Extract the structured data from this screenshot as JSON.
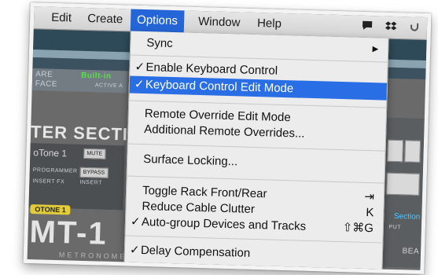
{
  "menubar": {
    "items": [
      {
        "label": "Edit"
      },
      {
        "label": "Create"
      },
      {
        "label": "Options"
      },
      {
        "label": "Window"
      },
      {
        "label": "Help"
      }
    ]
  },
  "background_app": {
    "section_title": "TER SECTION",
    "green_text": "Built-in",
    "label_are": "ARE",
    "label_face": "FACE",
    "label_active": "ACTIVE A",
    "tone_name": "oTone 1",
    "mute": "MUTE",
    "programmer": "PROGRAMMER",
    "bypass": "BYPASS",
    "insert_fx": "INSERT FX",
    "insert": "INSERT",
    "tag": "OTONE 1",
    "big_logo": "MT-1",
    "metronome": "METRONOME",
    "right_section": "Section",
    "right_put": "PUT",
    "right_bea": "BEA"
  },
  "options_menu": {
    "items": [
      {
        "label": "Sync",
        "checked": false,
        "shortcut": "▶"
      },
      {
        "label": "Enable Keyboard Control",
        "checked": true,
        "shortcut": ""
      },
      {
        "label": "Keyboard Control Edit Mode",
        "checked": true,
        "shortcut": "",
        "highlighted": true
      },
      {
        "label": "Remote Override Edit Mode",
        "checked": false,
        "shortcut": ""
      },
      {
        "label": "Additional Remote Overrides...",
        "checked": false,
        "shortcut": ""
      },
      {
        "label": "Surface Locking...",
        "checked": false,
        "shortcut": ""
      },
      {
        "label": "Toggle Rack Front/Rear",
        "checked": false,
        "shortcut": "⇥"
      },
      {
        "label": "Reduce Cable Clutter",
        "checked": false,
        "shortcut": "K"
      },
      {
        "label": "Auto-group Devices and Tracks",
        "checked": true,
        "shortcut": "⇧⌘G"
      },
      {
        "label": "Delay Compensation",
        "checked": true,
        "shortcut": ""
      }
    ],
    "check_glyph": "✓"
  },
  "colors": {
    "menu_highlight": "#2a6ee6",
    "menubar_active": "#2466d8",
    "green_led": "#59e04c"
  }
}
